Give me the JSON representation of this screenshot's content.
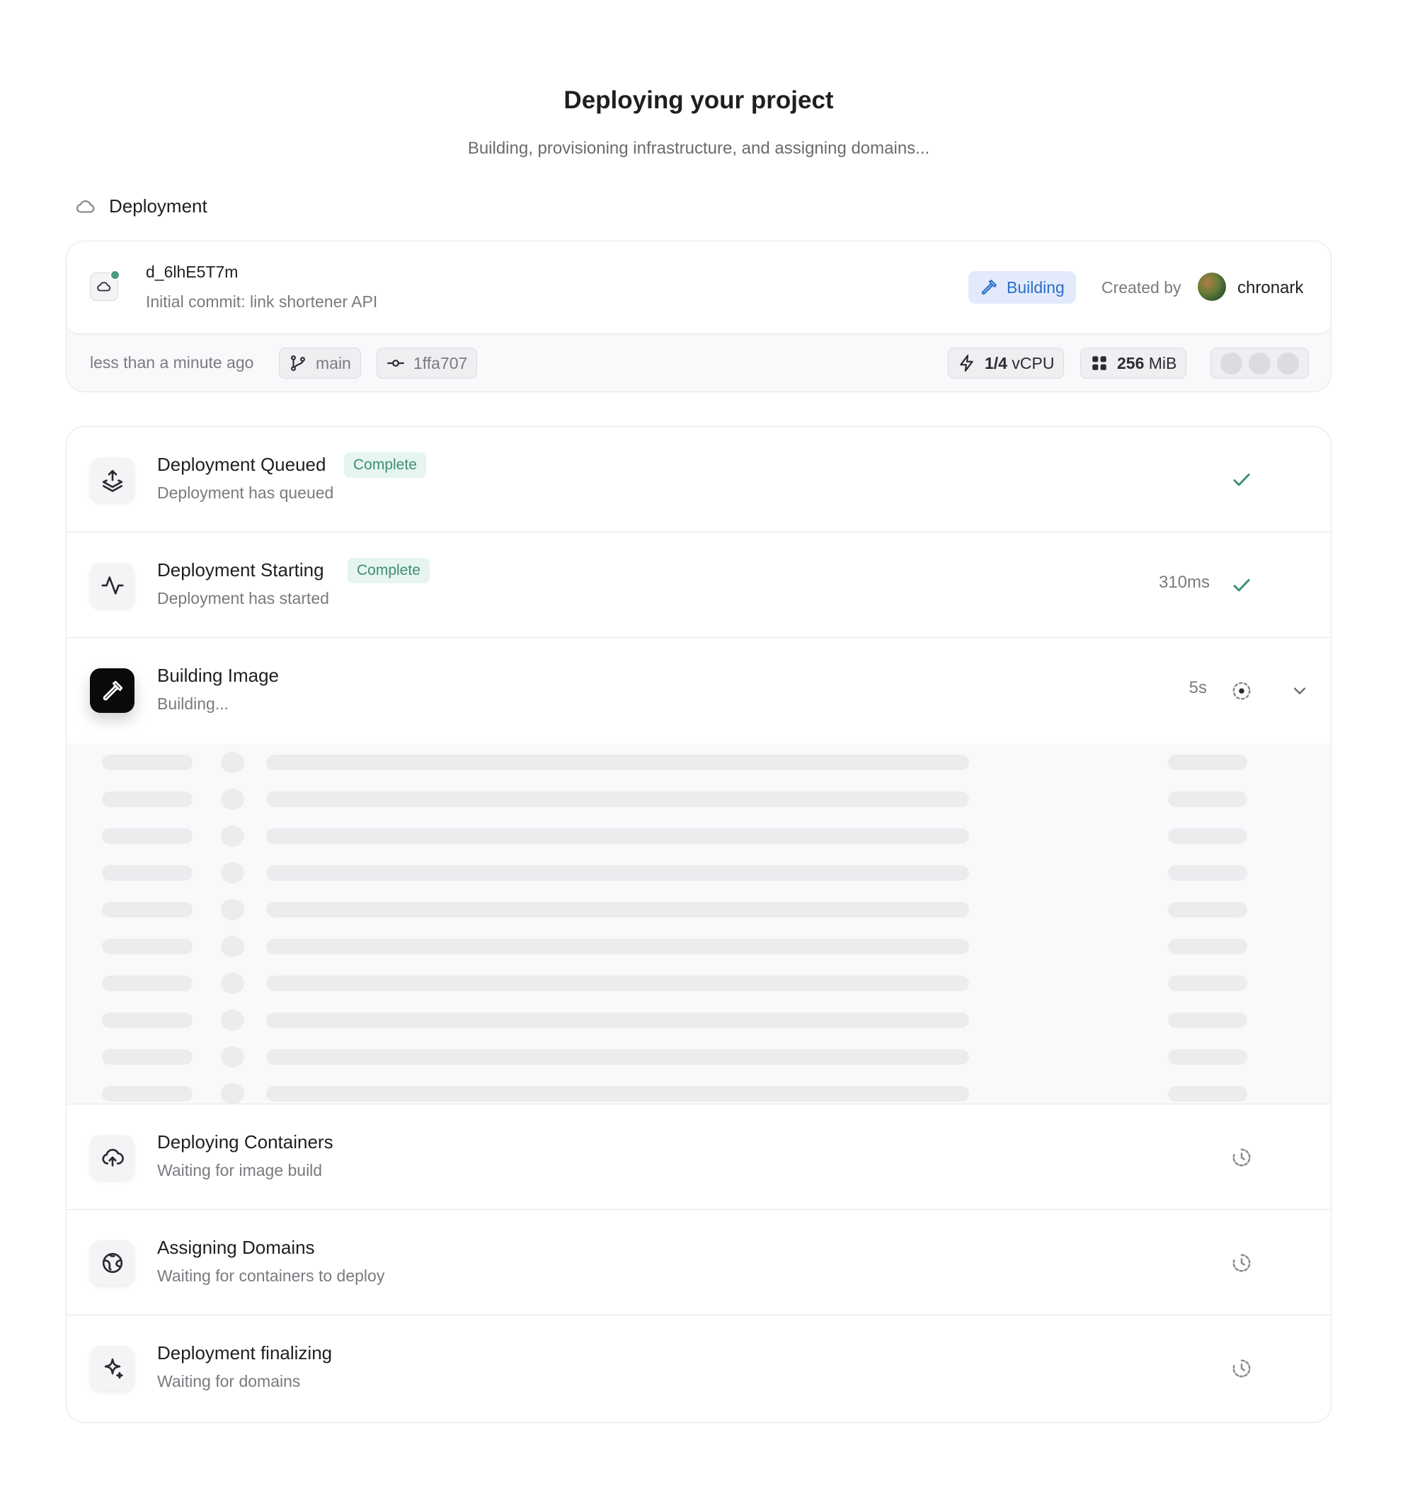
{
  "header": {
    "title": "Deploying your project",
    "subtitle": "Building, provisioning infrastructure, and assigning domains..."
  },
  "section": {
    "label": "Deployment",
    "icon": "cloud-icon"
  },
  "deployment": {
    "id": "d_6lhE5T7m",
    "commit_message": "Initial commit: link shortener API",
    "status_label": "Building",
    "created_by_label": "Created by",
    "creator": "chronark",
    "time_ago": "less than a minute ago",
    "branch": "main",
    "commit_hash": "1ffa707",
    "cpu_value": "1/4",
    "cpu_unit": "vCPU",
    "memory_value": "256",
    "memory_unit": "MiB",
    "colors": {
      "status_bg": "#e2eafc",
      "status_text": "#2d6ec8",
      "live_dot": "#4a9b84"
    }
  },
  "steps": [
    {
      "title": "Deployment Queued",
      "subtitle": "Deployment has queued",
      "badge": "Complete",
      "duration": "",
      "state": "complete",
      "icon": "queue-upload-icon"
    },
    {
      "title": "Deployment Starting",
      "subtitle": "Deployment has started",
      "badge": "Complete",
      "duration": "310ms",
      "state": "complete",
      "icon": "activity-pulse-icon"
    },
    {
      "title": "Building Image",
      "subtitle": "Building...",
      "badge": "",
      "duration": "5s",
      "state": "in-progress",
      "icon": "hammer-icon"
    },
    {
      "title": "Deploying Containers",
      "subtitle": "Waiting for image build",
      "badge": "",
      "duration": "",
      "state": "pending",
      "icon": "cloud-upload-icon"
    },
    {
      "title": "Assigning Domains",
      "subtitle": "Waiting for containers to deploy",
      "badge": "",
      "duration": "",
      "state": "pending",
      "icon": "globe-icon"
    },
    {
      "title": "Deployment finalizing",
      "subtitle": "Waiting for domains",
      "badge": "",
      "duration": "",
      "state": "pending",
      "icon": "sparkle-icon"
    }
  ],
  "colors": {
    "complete": "#3f8d73",
    "badge_bg": "#e6f5ee",
    "muted": "#7a7a80"
  }
}
